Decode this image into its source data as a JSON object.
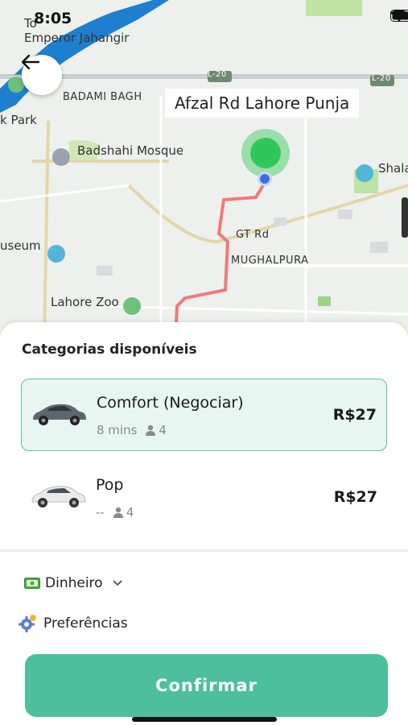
{
  "status_bar": {
    "time": "8:05"
  },
  "map": {
    "labels": {
      "emperor": "Emperor Jahangir",
      "badami": "BADAMI BAGH",
      "park": "k Park",
      "badshahi": "Badshahi Mosque",
      "museum": "useum",
      "zoo": "Lahore Zoo",
      "gt_rd": "GT Rd",
      "mughalpura": "MUGHALPURA",
      "shala": "Shala",
      "l20_a": "L-20",
      "l20_b": "L-20",
      "top_left": "To"
    },
    "address": "Afzal Rd  Lahore Punja",
    "colors": {
      "route": "#ef7a7a",
      "pin": "#2ec85a",
      "water": "#1e7fd1"
    }
  },
  "sheet": {
    "title": "Categorias disponíveis",
    "options": [
      {
        "name": "Comfort (Negociar)",
        "eta": "8 mins",
        "seats": "4",
        "price": "R$27",
        "selected": true
      },
      {
        "name": "Pop",
        "eta": "--",
        "seats": "4",
        "price": "R$27",
        "selected": false
      }
    ],
    "payment": {
      "label": "Dinheiro"
    },
    "preferences": {
      "label": "Preferências"
    },
    "confirm_label": "Confirmar",
    "colors": {
      "accent": "#4dbf9b",
      "selected_bg": "#e8f6f1"
    }
  }
}
